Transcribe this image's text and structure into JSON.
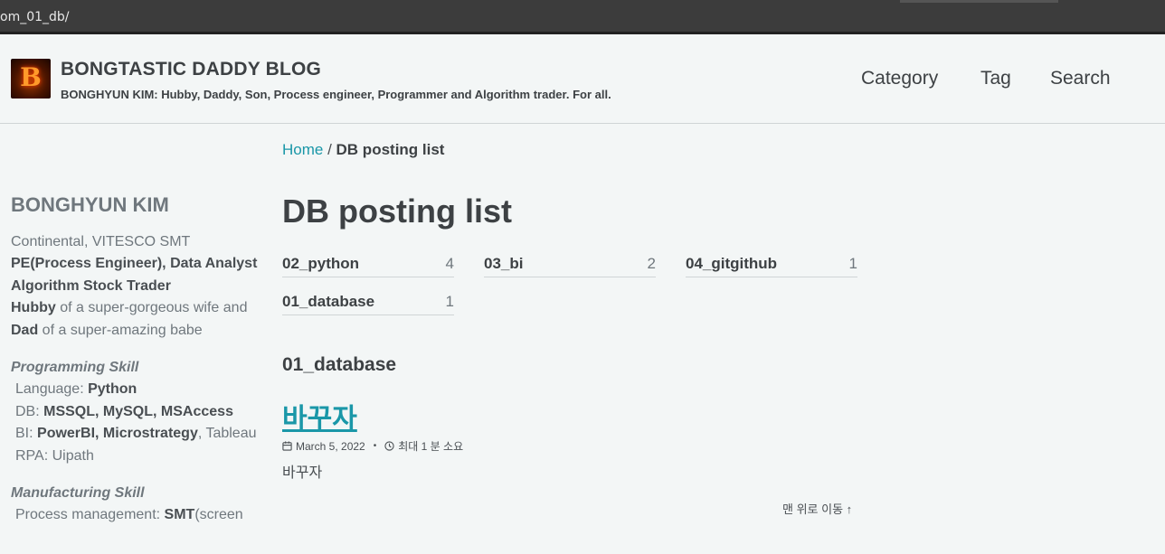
{
  "browser": {
    "url": "om_01_db/"
  },
  "header": {
    "logo_letter": "B",
    "title": "BONGTASTIC DADDY BLOG",
    "subtitle": "BONGHYUN KIM: Hubby, Daddy, Son, Process engineer, Programmer and Algorithm trader. For all.",
    "nav": [
      "Category",
      "Tag",
      "Search"
    ]
  },
  "sidebar": {
    "name": "BONGHYUN KIM",
    "company": "Continental, VITESCO SMT",
    "role1": "PE(Process Engineer), Data Analyst",
    "role2": "Algorithm Stock Trader",
    "hubby_b": "Hubby",
    "hubby_t": " of a super-gorgeous wife and",
    "dad_b": "Dad",
    "dad_t": " of a super-amazing babe",
    "prog_title": "Programming Skill",
    "lang_l": "Language: ",
    "lang_v": "Python",
    "db_l": "DB: ",
    "db_v": "MSSQL, MySQL, MSAccess",
    "bi_l": "BI: ",
    "bi_v": "PowerBI, Microstrategy",
    "bi_t": ", Tableau",
    "rpa": "RPA: Uipath",
    "mfg_title": "Manufacturing Skill",
    "proc_l": "Process management: ",
    "proc_v": "SMT",
    "proc_t": "(screen"
  },
  "breadcrumb": {
    "home": "Home",
    "sep": " / ",
    "current": "DB posting list"
  },
  "page": {
    "title": "DB posting list",
    "taxonomy": [
      {
        "name": "02_python",
        "count": "4"
      },
      {
        "name": "03_bi",
        "count": "2"
      },
      {
        "name": "04_gitgithub",
        "count": "1"
      },
      {
        "name": "01_database",
        "count": "1"
      }
    ],
    "section": "01_database",
    "post": {
      "title": "바꾸자",
      "date": "March 5, 2022",
      "read_time": "최대 1 분 소요",
      "excerpt": "바꾸자"
    },
    "back_to_top": "맨 위로 이동 ↑"
  }
}
